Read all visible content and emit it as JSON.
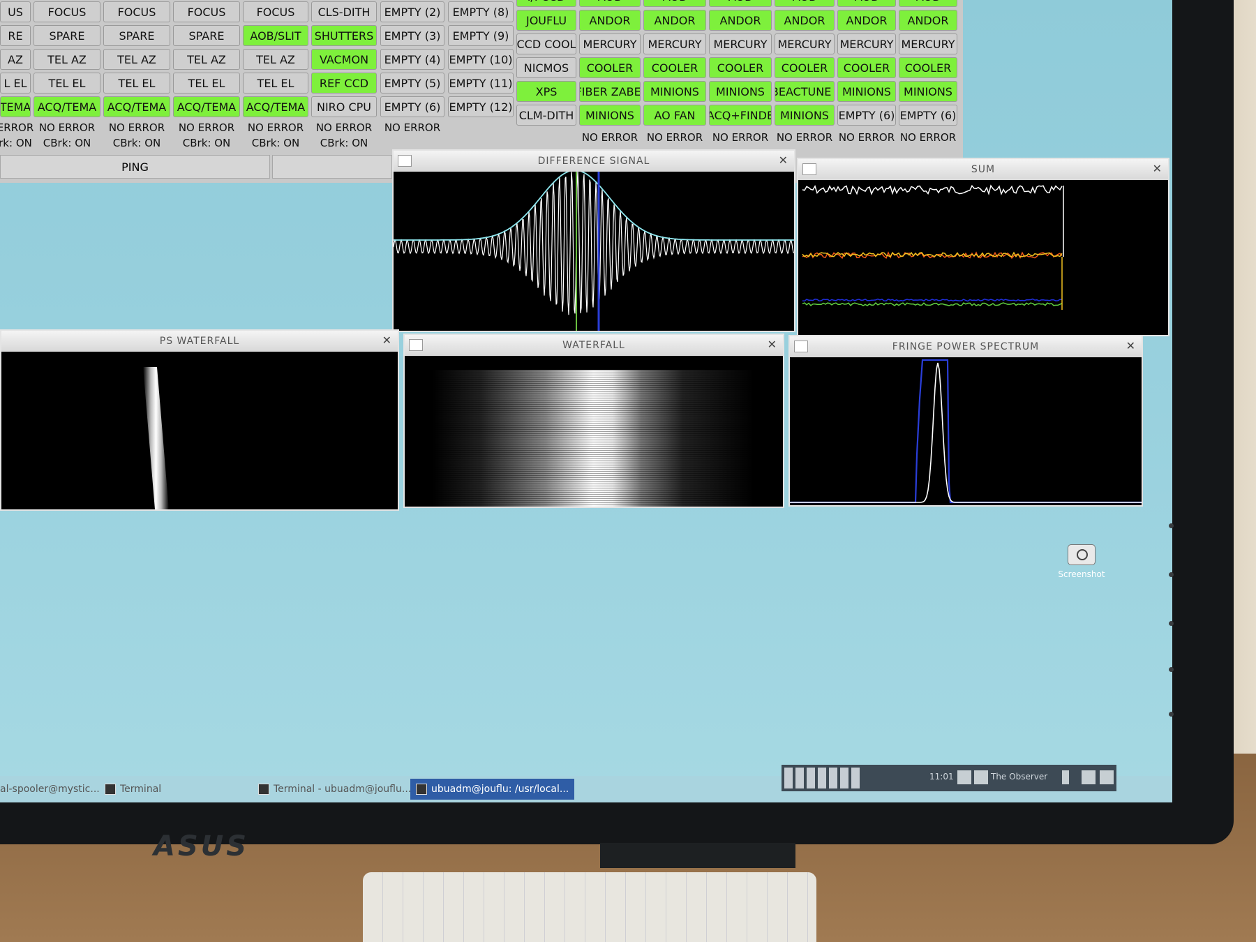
{
  "status_panel": {
    "columns": [
      {
        "rows": [
          [
            "US",
            "n"
          ],
          [
            "RE",
            "n"
          ],
          [
            "AZ",
            "n"
          ],
          [
            "L EL",
            "n"
          ],
          [
            "TEMA",
            "g"
          ]
        ],
        "errors": [
          "ERROR",
          "rk: ON"
        ]
      },
      {
        "rows": [
          [
            "FOCUS",
            "n"
          ],
          [
            "SPARE",
            "n"
          ],
          [
            "TEL AZ",
            "n"
          ],
          [
            "TEL EL",
            "n"
          ],
          [
            "ACQ/TEMA",
            "g"
          ]
        ],
        "errors": [
          "NO ERROR",
          "CBrk: ON"
        ]
      },
      {
        "rows": [
          [
            "FOCUS",
            "n"
          ],
          [
            "SPARE",
            "n"
          ],
          [
            "TEL AZ",
            "n"
          ],
          [
            "TEL EL",
            "n"
          ],
          [
            "ACQ/TEMA",
            "g"
          ]
        ],
        "errors": [
          "NO ERROR",
          "CBrk: ON"
        ]
      },
      {
        "rows": [
          [
            "FOCUS",
            "n"
          ],
          [
            "SPARE",
            "n"
          ],
          [
            "TEL AZ",
            "n"
          ],
          [
            "TEL EL",
            "n"
          ],
          [
            "ACQ/TEMA",
            "g"
          ]
        ],
        "errors": [
          "NO ERROR",
          "CBrk: ON"
        ]
      },
      {
        "rows": [
          [
            "FOCUS",
            "n"
          ],
          [
            "AOB/SLIT",
            "g"
          ],
          [
            "TEL AZ",
            "n"
          ],
          [
            "TEL EL",
            "n"
          ],
          [
            "ACQ/TEMA",
            "g"
          ]
        ],
        "errors": [
          "NO ERROR",
          "CBrk: ON"
        ]
      },
      {
        "rows": [
          [
            "CLS-DITH",
            "n"
          ],
          [
            "SHUTTERS",
            "g"
          ],
          [
            "VACMON",
            "g"
          ],
          [
            "REF CCD",
            "g"
          ],
          [
            "NIRO CPU",
            "n"
          ]
        ],
        "errors": [
          "NO ERROR",
          "CBrk: ON"
        ]
      },
      {
        "rows": [
          [
            "EMPTY (2)",
            "n"
          ],
          [
            "EMPTY (3)",
            "n"
          ],
          [
            "EMPTY (4)",
            "n"
          ],
          [
            "EMPTY (5)",
            "n"
          ],
          [
            "EMPTY (6)",
            "n"
          ]
        ],
        "errors": [
          "NO ERROR",
          ""
        ]
      },
      {
        "rows": [
          [
            "EMPTY (8)",
            "n"
          ],
          [
            "EMPTY (9)",
            "n"
          ],
          [
            "EMPTY (10)",
            "n"
          ],
          [
            "EMPTY (11)",
            "n"
          ],
          [
            "EMPTY (12)",
            "n"
          ]
        ],
        "errors": [
          "",
          ""
        ]
      },
      {
        "rows": [
          [
            "I/I CCD",
            "g"
          ],
          [
            "JOUFLU",
            "g"
          ],
          [
            "CCD COOL",
            "n"
          ],
          [
            "NICMOS",
            "n"
          ],
          [
            "XPS",
            "g"
          ],
          [
            "CLM-DITH",
            "n"
          ]
        ],
        "errors": [
          "",
          ""
        ]
      },
      {
        "rows": [
          [
            "AOB",
            "g"
          ],
          [
            "ANDOR",
            "g"
          ],
          [
            "MERCURY",
            "n"
          ],
          [
            "COOLER",
            "g"
          ],
          [
            "FIBER ZABEI",
            "g"
          ],
          [
            "MINIONS",
            "g"
          ]
        ],
        "errors": [
          "NO ERROR",
          ""
        ]
      },
      {
        "rows": [
          [
            "AOB",
            "g"
          ],
          [
            "ANDOR",
            "g"
          ],
          [
            "MERCURY",
            "n"
          ],
          [
            "COOLER",
            "g"
          ],
          [
            "MINIONS",
            "g"
          ],
          [
            "AO FAN",
            "g"
          ]
        ],
        "errors": [
          "NO ERROR",
          ""
        ]
      },
      {
        "rows": [
          [
            "AOB",
            "g"
          ],
          [
            "ANDOR",
            "g"
          ],
          [
            "MERCURY",
            "n"
          ],
          [
            "COOLER",
            "g"
          ],
          [
            "MINIONS",
            "g"
          ],
          [
            "ACQ+FINDE",
            "g"
          ]
        ],
        "errors": [
          "NO ERROR",
          ""
        ]
      },
      {
        "rows": [
          [
            "AOB",
            "g"
          ],
          [
            "ANDOR",
            "g"
          ],
          [
            "MERCURY",
            "n"
          ],
          [
            "COOLER",
            "g"
          ],
          [
            "BEACTUNE I",
            "g"
          ],
          [
            "MINIONS",
            "g"
          ]
        ],
        "errors": [
          "NO ERROR",
          ""
        ]
      },
      {
        "rows": [
          [
            "AOB",
            "g"
          ],
          [
            "ANDOR",
            "g"
          ],
          [
            "MERCURY",
            "n"
          ],
          [
            "COOLER",
            "g"
          ],
          [
            "MINIONS",
            "g"
          ],
          [
            "EMPTY (6)",
            "n"
          ]
        ],
        "errors": [
          "NO ERROR",
          ""
        ]
      },
      {
        "rows": [
          [
            "AOB",
            "g"
          ],
          [
            "ANDOR",
            "g"
          ],
          [
            "MERCURY",
            "n"
          ],
          [
            "COOLER",
            "g"
          ],
          [
            "MINIONS",
            "g"
          ],
          [
            "EMPTY (6)",
            "n"
          ]
        ],
        "errors": [
          "NO ERROR",
          ""
        ]
      }
    ],
    "ping_label": "PING"
  },
  "windows": {
    "difference": {
      "title": "DIFFERENCE SIGNAL"
    },
    "sum": {
      "title": "SUM"
    },
    "ps_waterfall": {
      "title": "PS WATERFALL"
    },
    "waterfall": {
      "title": "WATERFALL"
    },
    "fringe": {
      "title": "FRINGE POWER SPECTRUM"
    },
    "close_glyph": "✕"
  },
  "desktop": {
    "screenshot_label": "Screenshot"
  },
  "taskbar": {
    "items": [
      {
        "label": "al-spooler@mystic...",
        "active": false
      },
      {
        "label": "Terminal",
        "active": false
      },
      {
        "label": "Terminal - ubuadm@jouflu...",
        "active": false
      },
      {
        "label": "ubuadm@jouflu: /usr/local...",
        "active": true
      }
    ],
    "clock": "11:01",
    "user": "The Observer"
  },
  "monitor": {
    "brand": "ASUS"
  },
  "colors": {
    "green": "#7ef03c",
    "grey": "#cfcfcf",
    "desktop": "#9bd2df",
    "active_task": "#2f5da6"
  }
}
